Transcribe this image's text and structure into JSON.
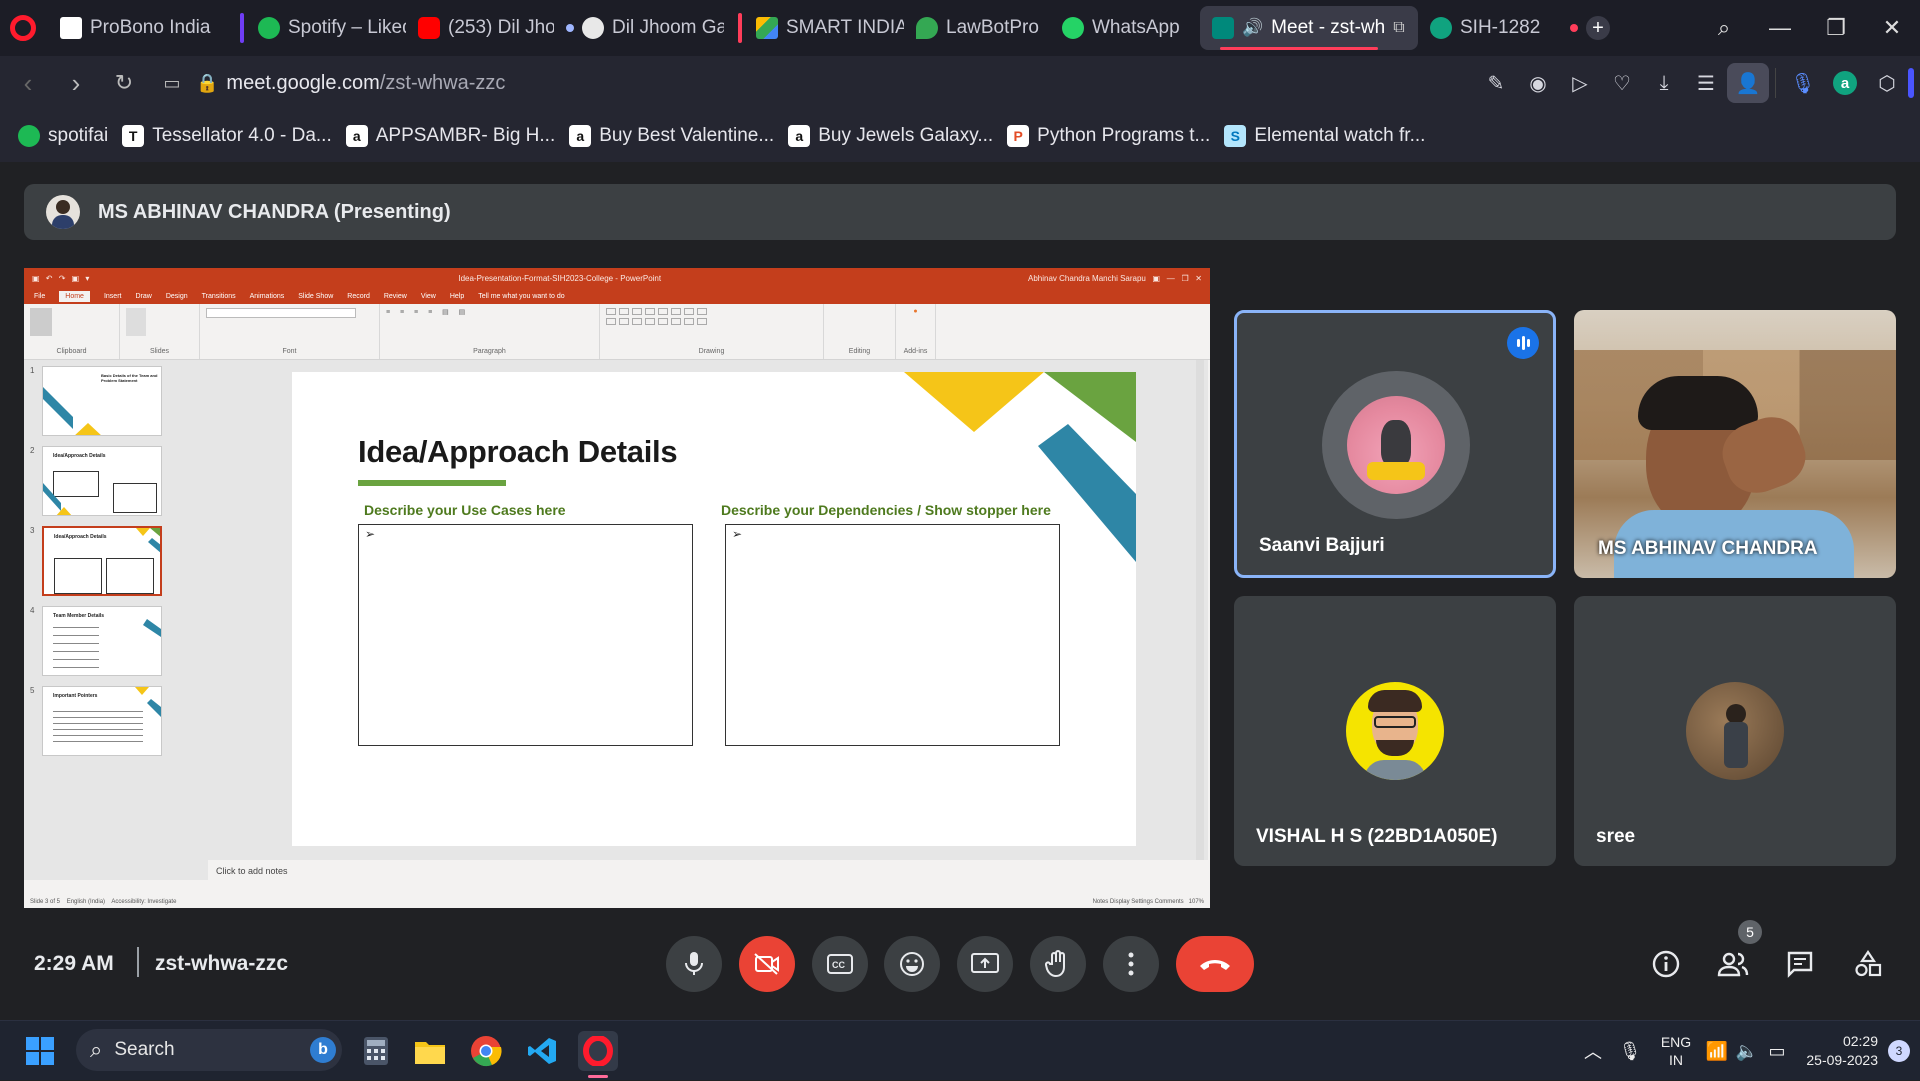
{
  "browser": {
    "tabs": [
      {
        "label": "ProBono India",
        "color": "#ffffff"
      },
      {
        "label": "Spotify – Liked",
        "color": "#1db954"
      },
      {
        "label": "(253) Dil Jhoom",
        "color": "#ff0000"
      },
      {
        "label": "Dil Jhoom Ga",
        "color": "#e8e8e8"
      },
      {
        "label": "SMART INDIA",
        "color": "#fbbc04"
      },
      {
        "label": "LawBotPro",
        "color": "#34a853"
      },
      {
        "label": "WhatsApp",
        "color": "#25d366"
      },
      {
        "label": "Meet - zst-wh",
        "color": "#00897b"
      },
      {
        "label": "SIH-1282",
        "color": "#10a37f"
      }
    ],
    "url_host": "meet.google.com",
    "url_path": "/zst-whwa-zzc",
    "bookmarks": [
      {
        "label": "spotifai",
        "color": "#1db954",
        "glyph": ""
      },
      {
        "label": "Tessellator 4.0 - Da...",
        "color": "#ffffff",
        "glyph": "T"
      },
      {
        "label": "APPSAMBR- Big H...",
        "color": "#ffffff",
        "glyph": "a"
      },
      {
        "label": "Buy Best Valentine...",
        "color": "#ffffff",
        "glyph": "a"
      },
      {
        "label": "Buy Jewels Galaxy...",
        "color": "#ffffff",
        "glyph": "a"
      },
      {
        "label": "Python Programs t...",
        "color": "#e34c26",
        "glyph": "P"
      },
      {
        "label": "Elemental watch fr...",
        "color": "#b3e5fc",
        "glyph": "S"
      }
    ]
  },
  "meet": {
    "presenting_label": "MS ABHINAV CHANDRA (Presenting)",
    "time": "2:29 AM",
    "meeting_code": "zst-whwa-zzc",
    "participant_count": "5",
    "participants": [
      {
        "name": "Saanvi Bajjuri"
      },
      {
        "name": "MS ABHINAV CHANDRA"
      },
      {
        "name": "VISHAL H S (22BD1A050E)"
      },
      {
        "name": "sree"
      }
    ]
  },
  "ppt": {
    "file_title": "Idea-Presentation-Format-SIH2023-College - PowerPoint",
    "user": "Abhinav Chandra Manchi Sarapu",
    "menu": [
      "File",
      "Home",
      "Insert",
      "Draw",
      "Design",
      "Transitions",
      "Animations",
      "Slide Show",
      "Record",
      "Review",
      "View",
      "Help",
      "Tell me what you want to do"
    ],
    "ribbon_groups": [
      "Clipboard",
      "Slides",
      "Font",
      "Paragraph",
      "Drawing",
      "Editing",
      "Add-ins"
    ],
    "slide_title": "Idea/Approach Details",
    "left_heading": "Describe your Use Cases here",
    "right_heading": "Describe your Dependencies / Show stopper here",
    "notes_placeholder": "Click to add notes",
    "status_left": "Slide 3 of 5",
    "status_lang": "English (India)",
    "status_access": "Accessibility: Investigate",
    "status_right": "Notes   Display Settings   Comments",
    "zoom": "107%",
    "thumbs": [
      {
        "num": "1",
        "title": "Basic Details of the Team and Problem Statement"
      },
      {
        "num": "2",
        "title": "Idea/Approach Details"
      },
      {
        "num": "3",
        "title": "Idea/Approach Details"
      },
      {
        "num": "4",
        "title": "Team Member Details"
      },
      {
        "num": "5",
        "title": "Important Pointers"
      }
    ]
  },
  "taskbar": {
    "search_placeholder": "Search",
    "lang": "ENG",
    "region": "IN",
    "time": "02:29",
    "date": "25-09-2023",
    "notif_count": "3"
  },
  "colors": {
    "brand_red": "#ea4335",
    "ppt_accent": "#c43e1c",
    "meet_bg": "#202124",
    "tile_bg": "#3c4043"
  }
}
